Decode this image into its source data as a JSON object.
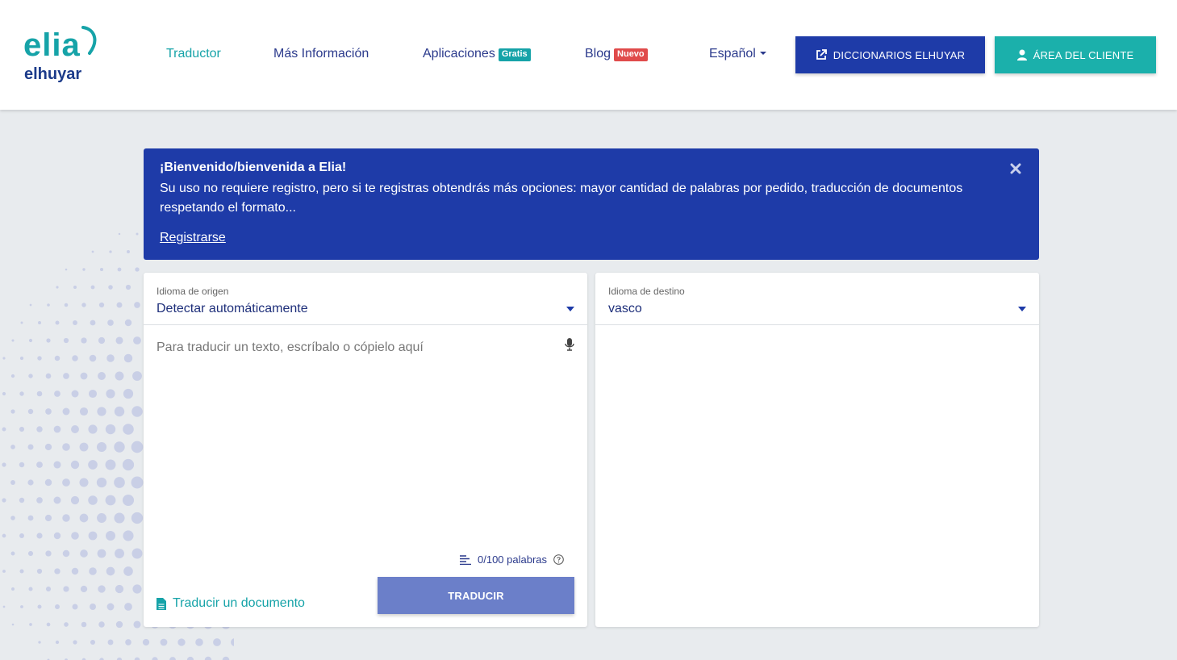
{
  "logo": {
    "top": "elia",
    "bottom": "elhuyar"
  },
  "nav": {
    "translator": "Traductor",
    "more_info": "Más Información",
    "apps": "Aplicaciones",
    "apps_badge": "Gratis",
    "blog": "Blog",
    "blog_badge": "Nuevo",
    "language": "Español"
  },
  "buttons": {
    "dictionaries": "DICCIONARIOS ELHUYAR",
    "client_area": "ÁREA DEL CLIENTE"
  },
  "banner": {
    "title": "¡Bienvenido/bienvenida a Elia!",
    "text": "Su uso no requiere registro, pero si te registras obtendrás más opciones: mayor cantidad de palabras por pedido, traducción de documentos respetando el formato...",
    "register": "Registrarse"
  },
  "source": {
    "label": "Idioma de origen",
    "value": "Detectar automáticamente",
    "placeholder": "Para traducir un texto, escríbalo o cópielo aquí",
    "word_count": "0/100 palabras",
    "translate_doc": "Traducir un documento",
    "translate_button": "TRADUCIR"
  },
  "target": {
    "label": "Idioma de destino",
    "value": "vasco"
  },
  "colors": {
    "brand_teal": "#16a3a8",
    "brand_blue": "#1e3ba8",
    "translate_button": "#6b7fc9",
    "badge_red": "#e04b4b"
  },
  "icons": [
    "external-link-icon",
    "user-icon",
    "close-icon",
    "microphone-icon",
    "text-lines-icon",
    "help-circle-icon",
    "document-icon",
    "caret-down-icon"
  ]
}
